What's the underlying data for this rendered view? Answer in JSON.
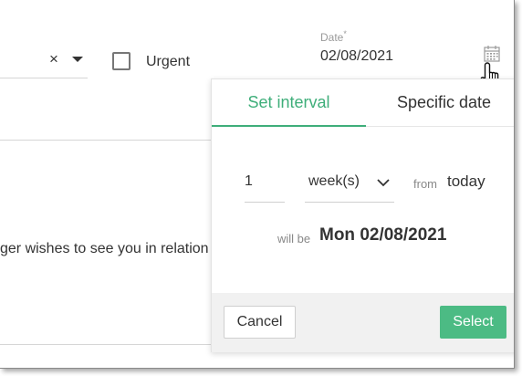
{
  "form": {
    "clear_glyph": "×",
    "urgent_label": "Urgent",
    "urgent_checked": false,
    "date_label": "Date",
    "date_required_mark": "*",
    "date_value": "02/08/2021",
    "body_text": "ger wishes to see you in relation"
  },
  "popup": {
    "tabs": [
      {
        "label": "Set interval",
        "active": true
      },
      {
        "label": "Specific date",
        "active": false
      }
    ],
    "interval_value": "1",
    "unit_value": "week(s)",
    "from_label": "from",
    "from_value": "today",
    "will_be_label": "will be",
    "will_be_value": "Mon 02/08/2021",
    "cancel_label": "Cancel",
    "select_label": "Select"
  },
  "icons": {
    "clear": "close-icon",
    "dropdown": "caret-down-icon",
    "calendar": "calendar-icon",
    "cursor": "hand-pointer-icon",
    "unit_dropdown": "chevron-down-icon"
  },
  "colors": {
    "accent": "#3fae7a",
    "select_button": "#4cbb84",
    "footer_bg": "#f1f1f1"
  }
}
